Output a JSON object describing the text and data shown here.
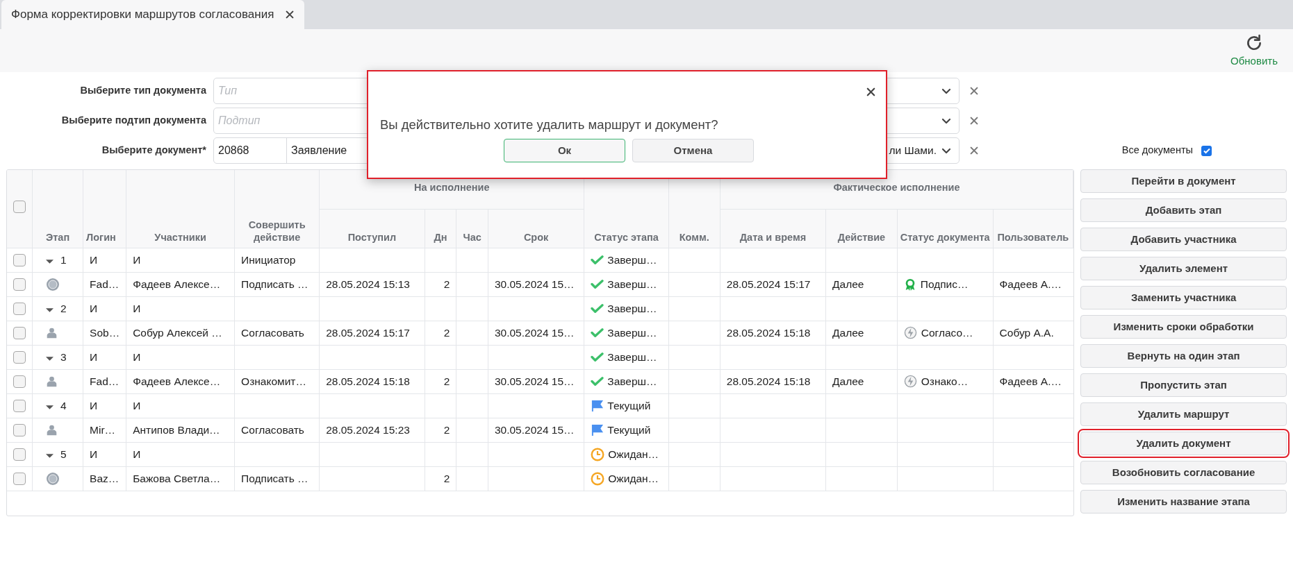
{
  "tab": {
    "title": "Форма корректировки маршрутов согласования",
    "selected": true
  },
  "toolbar": {
    "refresh": "Обновить"
  },
  "filters": [
    {
      "label": "Выберите тип документа",
      "placeholder": "Тип"
    },
    {
      "label": "Выберите подтип документа",
      "placeholder": "Подтип"
    },
    {
      "label": "Выберите документ*",
      "number": "20868",
      "value_start": "Заявление",
      "value_end": "ли Шами."
    }
  ],
  "all_documents": {
    "label": "Все документы",
    "checked": true
  },
  "table": {
    "header_checked": false,
    "columns": {
      "stage": "Этап",
      "login": "Логин",
      "participants": "Участники",
      "action": "Совершить действие",
      "group_1": "На исполнение",
      "received": "Поступил",
      "days": "Дн",
      "hours": "Час",
      "deadline": "Срок",
      "stage_status": "Статус этапа",
      "comment": "Комм.",
      "group_2": "Фактическое исполнение",
      "fact_date": "Дата и время",
      "fact_action": "Действие",
      "doc_status": "Статус документа",
      "user": "Пользователь"
    },
    "rows": [
      {
        "kind": "stage",
        "checked": false,
        "expanded": true,
        "stage": "1",
        "login": "И",
        "participants": "И",
        "action": "Инициатор",
        "status": {
          "kind": "done",
          "text": "Заверш…"
        }
      },
      {
        "kind": "signer",
        "checked": false,
        "login": "Fad…",
        "participants": "Фадеев Алексе…",
        "action": "Подписать …",
        "received": "28.05.2024 15:13",
        "days": "2",
        "deadline": "30.05.2024 15…",
        "status": {
          "kind": "done",
          "text": "Заверш…"
        },
        "fact_date": "28.05.2024 15:17",
        "fact_action": "Далее",
        "doc_status": {
          "kind": "award",
          "text": "Подпис…"
        },
        "user": "Фадеев А.…"
      },
      {
        "kind": "stage",
        "checked": false,
        "expanded": true,
        "stage": "2",
        "login": "И",
        "participants": "И",
        "status": {
          "kind": "done",
          "text": "Заверш…"
        }
      },
      {
        "kind": "approver",
        "checked": false,
        "login": "Sob…",
        "participants": "Собур Алексей …",
        "action": "Согласовать",
        "received": "28.05.2024 15:17",
        "days": "2",
        "deadline": "30.05.2024 15…",
        "status": {
          "kind": "done",
          "text": "Заверш…"
        },
        "fact_date": "28.05.2024 15:18",
        "fact_action": "Далее",
        "doc_status": {
          "kind": "bolt",
          "text": "Согласо…"
        },
        "user": "Собур А.А."
      },
      {
        "kind": "stage",
        "checked": false,
        "expanded": true,
        "stage": "3",
        "login": "И",
        "participants": "И",
        "status": {
          "kind": "done",
          "text": "Заверш…"
        }
      },
      {
        "kind": "approver",
        "checked": false,
        "login": "Fad…",
        "participants": "Фадеев Алексе…",
        "action": "Ознакомит…",
        "received": "28.05.2024 15:18",
        "days": "2",
        "deadline": "30.05.2024 15…",
        "status": {
          "kind": "done",
          "text": "Заверш…"
        },
        "fact_date": "28.05.2024 15:18",
        "fact_action": "Далее",
        "doc_status": {
          "kind": "bolt",
          "text": "Ознако…"
        },
        "user": "Фадеев А.…"
      },
      {
        "kind": "stage",
        "checked": false,
        "expanded": true,
        "stage": "4",
        "login": "И",
        "participants": "И",
        "status": {
          "kind": "current",
          "text": "Текущий"
        }
      },
      {
        "kind": "approver",
        "checked": false,
        "login": "Mir…",
        "participants": "Антипов Влади…",
        "action": "Согласовать",
        "received": "28.05.2024 15:23",
        "days": "2",
        "deadline": "30.05.2024 15…",
        "status": {
          "kind": "current",
          "text": "Текущий"
        }
      },
      {
        "kind": "stage",
        "checked": false,
        "expanded": true,
        "stage": "5",
        "login": "И",
        "participants": "И",
        "status": {
          "kind": "waiting",
          "text": "Ожидан…"
        }
      },
      {
        "kind": "signer",
        "checked": false,
        "login": "Baz…",
        "participants": "Бажова Светла…",
        "action": "Подписать …",
        "days": "2",
        "status": {
          "kind": "waiting",
          "text": "Ожидан…"
        }
      }
    ]
  },
  "actions": [
    {
      "label": "Перейти в документ",
      "highlighted": false
    },
    {
      "label": "Добавить этап",
      "highlighted": false
    },
    {
      "label": "Добавить участника",
      "highlighted": false
    },
    {
      "label": "Удалить элемент",
      "highlighted": false
    },
    {
      "label": "Заменить участника",
      "highlighted": false
    },
    {
      "label": "Изменить сроки обработки",
      "highlighted": false
    },
    {
      "label": "Вернуть на один этап",
      "highlighted": false
    },
    {
      "label": "Пропустить этап",
      "highlighted": false
    },
    {
      "label": "Удалить маршрут",
      "highlighted": false
    },
    {
      "label": "Удалить документ",
      "highlighted": true
    },
    {
      "label": "Возобновить согласование",
      "highlighted": false
    },
    {
      "label": "Изменить название этапа",
      "highlighted": false
    }
  ],
  "dialog": {
    "highlighted": true,
    "message": "Вы действительно хотите удалить маршрут и документ?",
    "ok": "Ок",
    "cancel": "Отмена"
  }
}
